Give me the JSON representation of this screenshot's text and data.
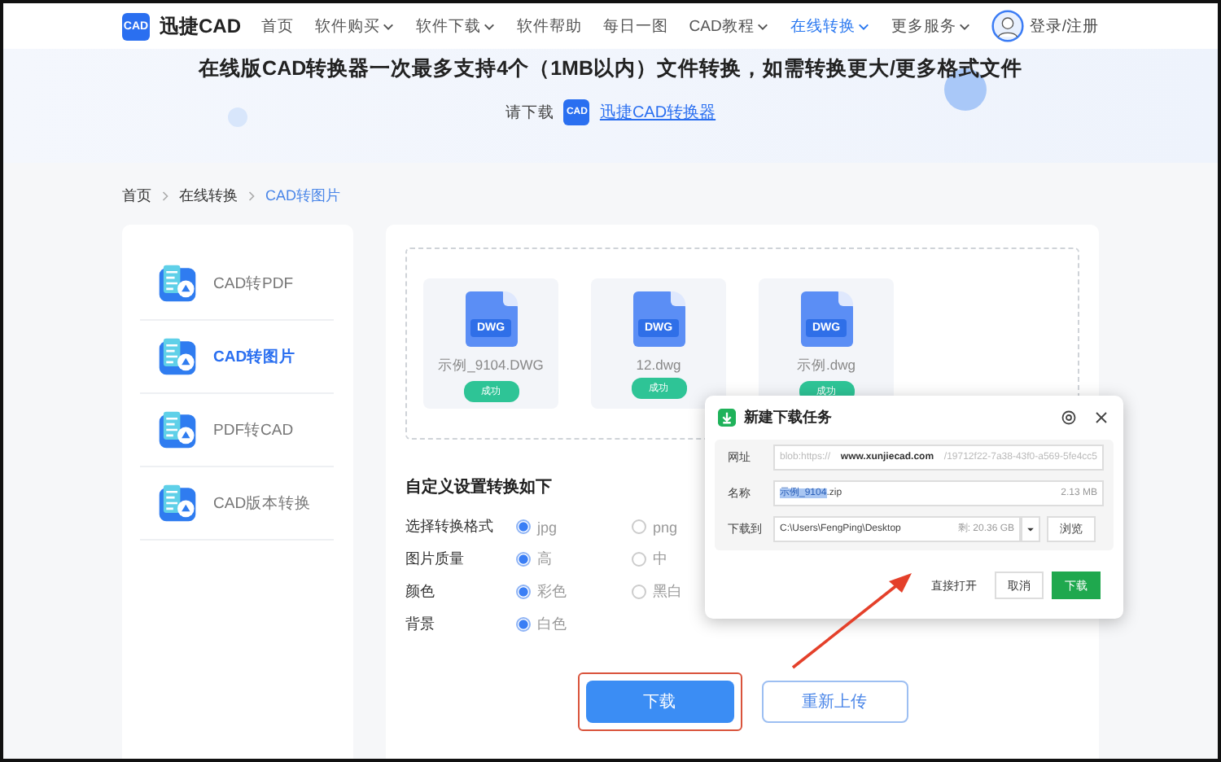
{
  "nav": {
    "logo_mark": "CAD",
    "logo_text": "迅捷CAD",
    "items": [
      {
        "label": "首页",
        "dropdown": false,
        "selected": false
      },
      {
        "label": "软件购买",
        "dropdown": true,
        "selected": false
      },
      {
        "label": "软件下载",
        "dropdown": true,
        "selected": false
      },
      {
        "label": "软件帮助",
        "dropdown": false,
        "selected": false
      },
      {
        "label": "每日一图",
        "dropdown": false,
        "selected": false
      },
      {
        "label": "CAD教程",
        "dropdown": true,
        "selected": false
      },
      {
        "label": "在线转换",
        "dropdown": true,
        "selected": true
      },
      {
        "label": "更多服务",
        "dropdown": true,
        "selected": false
      }
    ],
    "login": "登录/注册"
  },
  "banner": {
    "headline": "在线版CAD转换器一次最多支持4个（1MB以内）文件转换，如需转换更大/更多格式文件",
    "prompt": "请下载",
    "app_mark": "CAD",
    "link": "迅捷CAD转换器"
  },
  "breadcrumb": [
    {
      "label": "首页",
      "selected": false
    },
    {
      "label": "在线转换",
      "selected": false
    },
    {
      "label": "CAD转图片",
      "selected": true
    }
  ],
  "sidebar": {
    "items": [
      {
        "label": "CAD转PDF",
        "selected": false
      },
      {
        "label": "CAD转图片",
        "selected": true
      },
      {
        "label": "PDF转CAD",
        "selected": false
      },
      {
        "label": "CAD版本转换",
        "selected": false
      }
    ]
  },
  "files": [
    {
      "type_label": "DWG",
      "name": "示例_9104.DWG",
      "status": "成功"
    },
    {
      "type_label": "DWG",
      "name": "12.dwg",
      "status": "成功"
    },
    {
      "type_label": "DWG",
      "name": "示例.dwg",
      "status": "成功"
    }
  ],
  "settings": {
    "title": "自定义设置转换如下",
    "rows": [
      {
        "label": "选择转换格式",
        "options": [
          {
            "label": "jpg",
            "selected": true
          },
          {
            "label": "png",
            "selected": false
          }
        ]
      },
      {
        "label": "图片质量",
        "options": [
          {
            "label": "高",
            "selected": true
          },
          {
            "label": "中",
            "selected": false
          }
        ]
      },
      {
        "label": "颜色",
        "options": [
          {
            "label": "彩色",
            "selected": true
          },
          {
            "label": "黑白",
            "selected": false
          }
        ]
      },
      {
        "label": "背景",
        "options": [
          {
            "label": "白色",
            "selected": true
          }
        ]
      }
    ]
  },
  "actions": {
    "download": {
      "label": "下载",
      "highlighted": true
    },
    "reupload": {
      "label": "重新上传"
    }
  },
  "dialog": {
    "title": "新建下载任务",
    "url_label": "网址",
    "url": "blob:https://**www.xunjiecad.com**/19712f22-7a38-43f0-a569-5fe4cc5",
    "name_label": "名称",
    "name_selected": "示例_9104",
    "name_rest": ".zip",
    "size": "2.13 MB",
    "save_label": "下载到",
    "path": "C:\\Users\\FengPing\\Desktop",
    "free": "剩: 20.36 GB",
    "browse": "浏览",
    "open": "直接打开",
    "cancel": "取消",
    "download": "下载"
  }
}
